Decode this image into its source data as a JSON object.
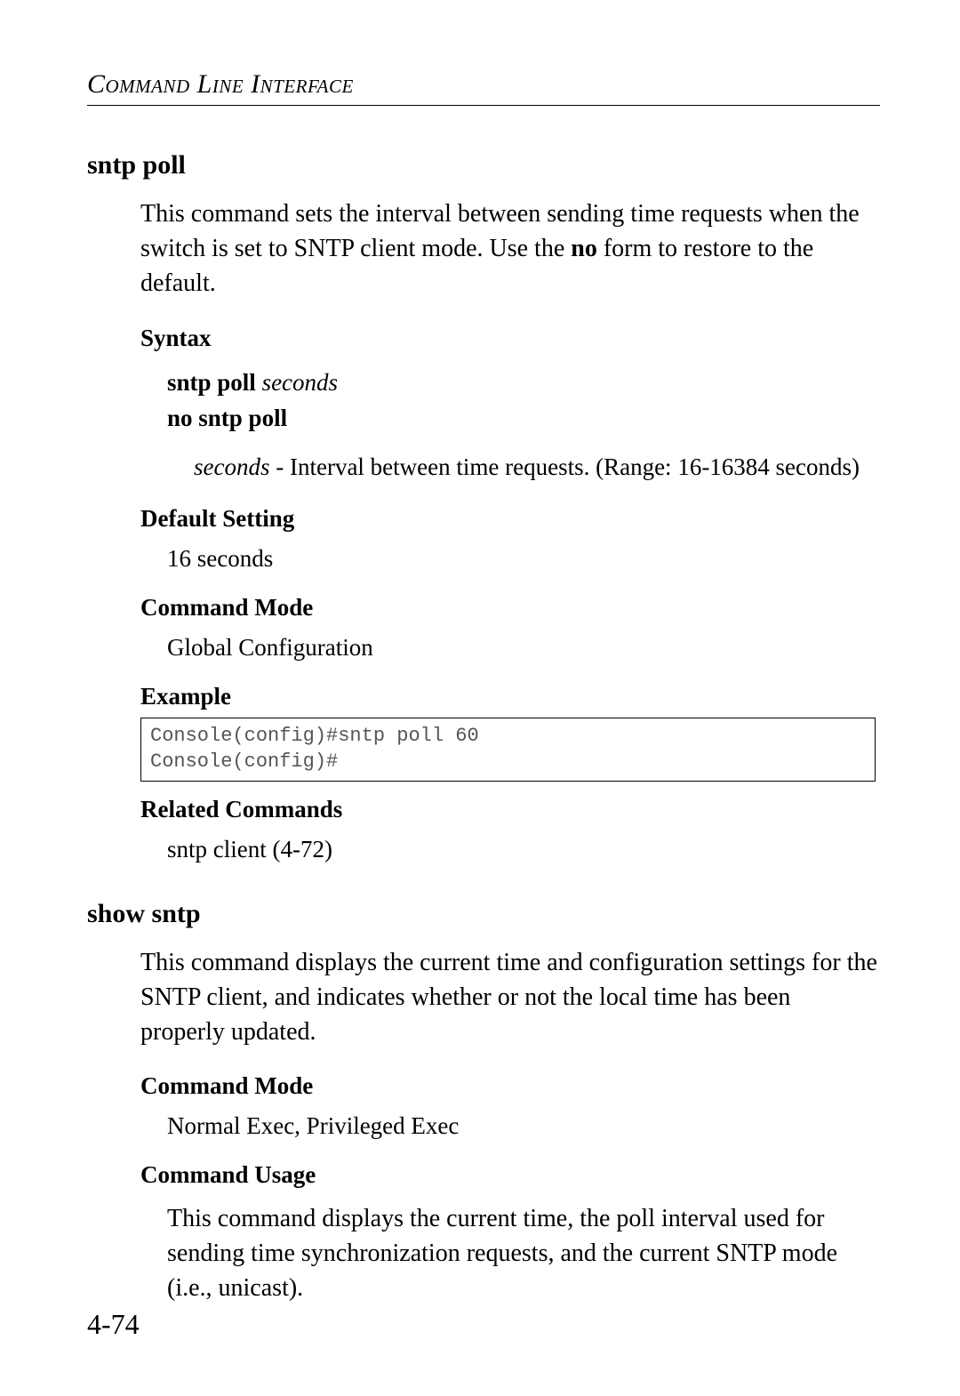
{
  "running_head": "Command Line Interface",
  "page_number": "4-74",
  "sections": {
    "sntp_poll": {
      "title": "sntp poll",
      "intro_a": "This command sets the interval between sending time requests when the switch is set to SNTP client mode. Use the ",
      "intro_bold": "no",
      "intro_b": " form to restore to the default.",
      "syntax_label": "Syntax",
      "syntax_cmd1": "sntp poll",
      "syntax_arg1": "seconds",
      "syntax_cmd2": "no sntp poll",
      "param_name": "seconds",
      "param_desc": " - Interval between time requests. (Range: 16-16384 seconds)",
      "default_label": "Default Setting",
      "default_value": "16 seconds",
      "mode_label": "Command Mode",
      "mode_value": "Global Configuration",
      "example_label": "Example",
      "example_code": "Console(config)#sntp poll 60\nConsole(config)#",
      "related_label": "Related Commands",
      "related_value": "sntp client (4-72)"
    },
    "show_sntp": {
      "title": "show sntp",
      "intro": "This command displays the current time and configuration settings for the SNTP client, and indicates whether or not the local time has been properly updated.",
      "mode_label": "Command Mode",
      "mode_value": "Normal Exec, Privileged Exec",
      "usage_label": "Command Usage",
      "usage_text": "This command displays the current time, the poll interval used for sending time synchronization requests, and the current SNTP mode (i.e., unicast)."
    }
  }
}
